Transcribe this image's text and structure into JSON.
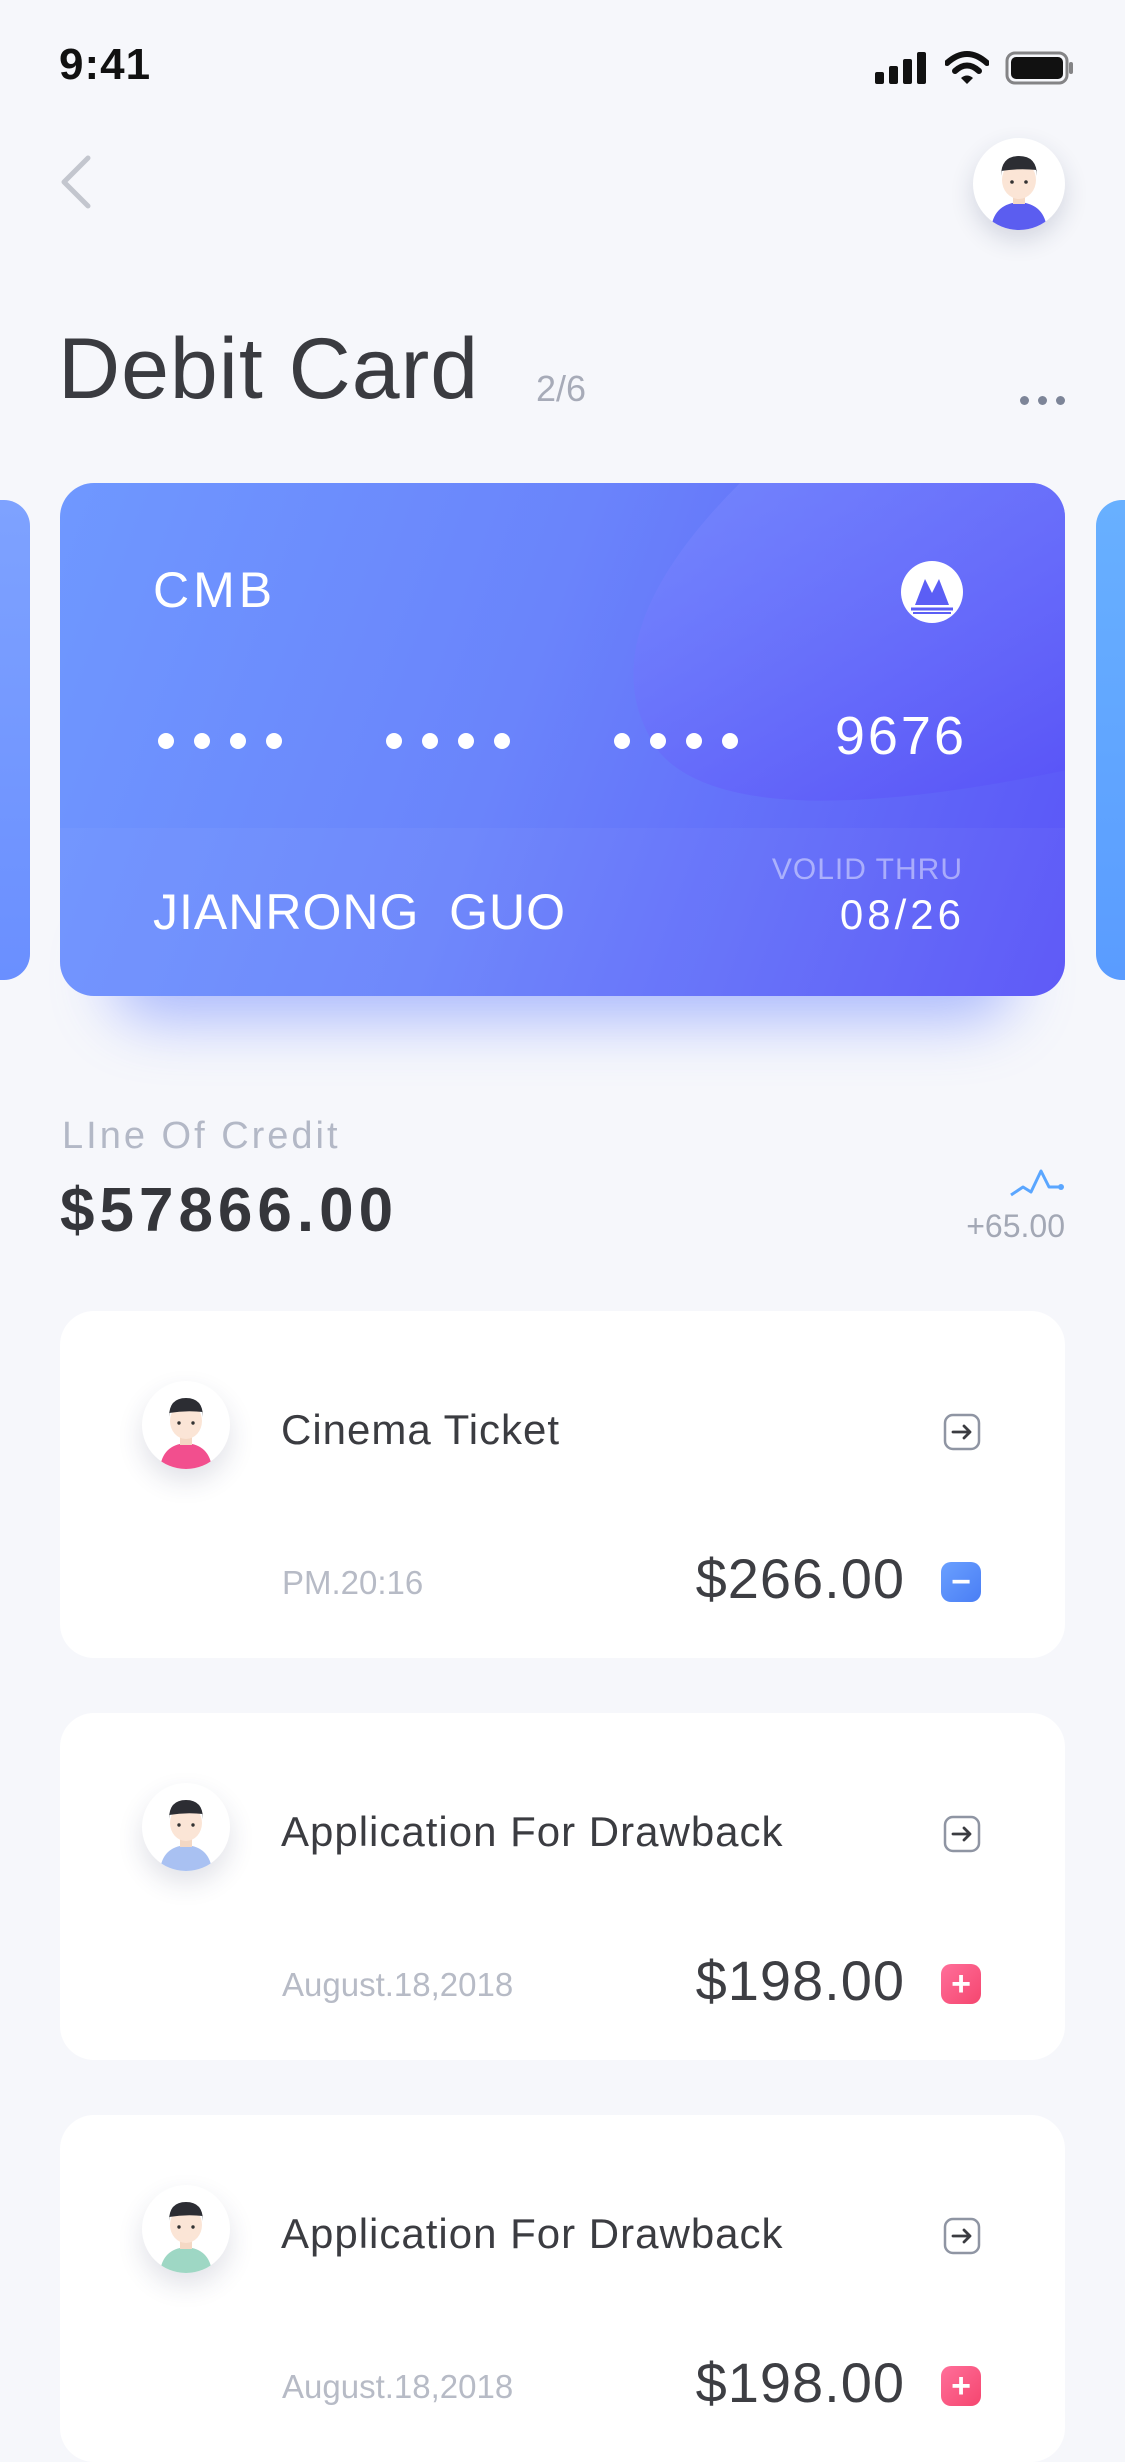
{
  "status_bar": {
    "time": "9:41"
  },
  "header": {
    "title": "Debit Card",
    "counter": "2/6"
  },
  "card": {
    "bank": "CMB",
    "masked_groups": [
      "••••",
      "••••",
      "••••"
    ],
    "last4": "9676",
    "holder": "JIANRONG  GUO",
    "valid_label": "VOLID THRU",
    "valid": "08/26",
    "colors": {
      "start": "#6f98ff",
      "end": "#5a55f7"
    }
  },
  "credit": {
    "label": "LIne Of Credit",
    "value": "$57866.00",
    "change": "+65.00"
  },
  "transactions": [
    {
      "title": "Cinema Ticket",
      "date": "PM.20:16",
      "amount": "$266.00",
      "badge": "−",
      "badge_type": "minus"
    },
    {
      "title": "Application For Drawback",
      "date": "August.18,2018",
      "amount": "$198.00",
      "badge": "+",
      "badge_type": "plus"
    },
    {
      "title": "Application For Drawback",
      "date": "August.18,2018",
      "amount": "$198.00",
      "badge": "+",
      "badge_type": "plus"
    }
  ],
  "icons": [
    "signal-icon",
    "wifi-icon",
    "battery-icon",
    "back-chevron-icon",
    "more-icon",
    "bank-logo-icon",
    "trend-icon",
    "arrow-right-icon"
  ]
}
